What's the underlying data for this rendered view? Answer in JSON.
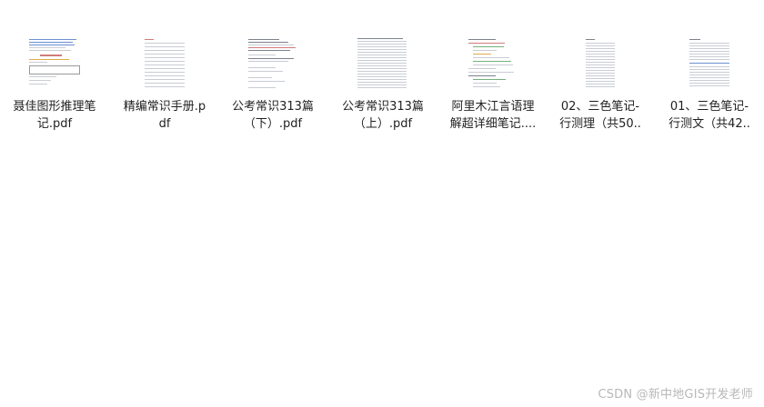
{
  "files": [
    {
      "name": "聂佳图形推理笔记.pdf",
      "display": "聂佳图形推理笔\n记.pdf",
      "icon": "pdf-document-thumbnail"
    },
    {
      "name": "精编常识手册.pdf",
      "display": "精编常识手册.p\ndf",
      "icon": "pdf-document-thumbnail"
    },
    {
      "name": "公考常识313篇（下）.pdf",
      "display": "公考常识313篇\n（下）.pdf",
      "icon": "pdf-document-thumbnail"
    },
    {
      "name": "公考常识313篇（上）.pdf",
      "display": "公考常识313篇\n（上）.pdf",
      "icon": "pdf-document-thumbnail"
    },
    {
      "name": "阿里木江言语理解超详细笔记....",
      "display": "阿里木江言语理\n解超详细笔记....",
      "icon": "pdf-document-thumbnail"
    },
    {
      "name": "02、三色笔记-行测理（共50...",
      "display": "02、三色笔记-\n行测理（共50..",
      "icon": "pdf-document-thumbnail"
    },
    {
      "name": "01、三色笔记-行测文（共42...",
      "display": "01、三色笔记-\n行测文（共42..",
      "icon": "pdf-document-thumbnail"
    }
  ],
  "watermark": "CSDN @新中地GIS开发老师"
}
